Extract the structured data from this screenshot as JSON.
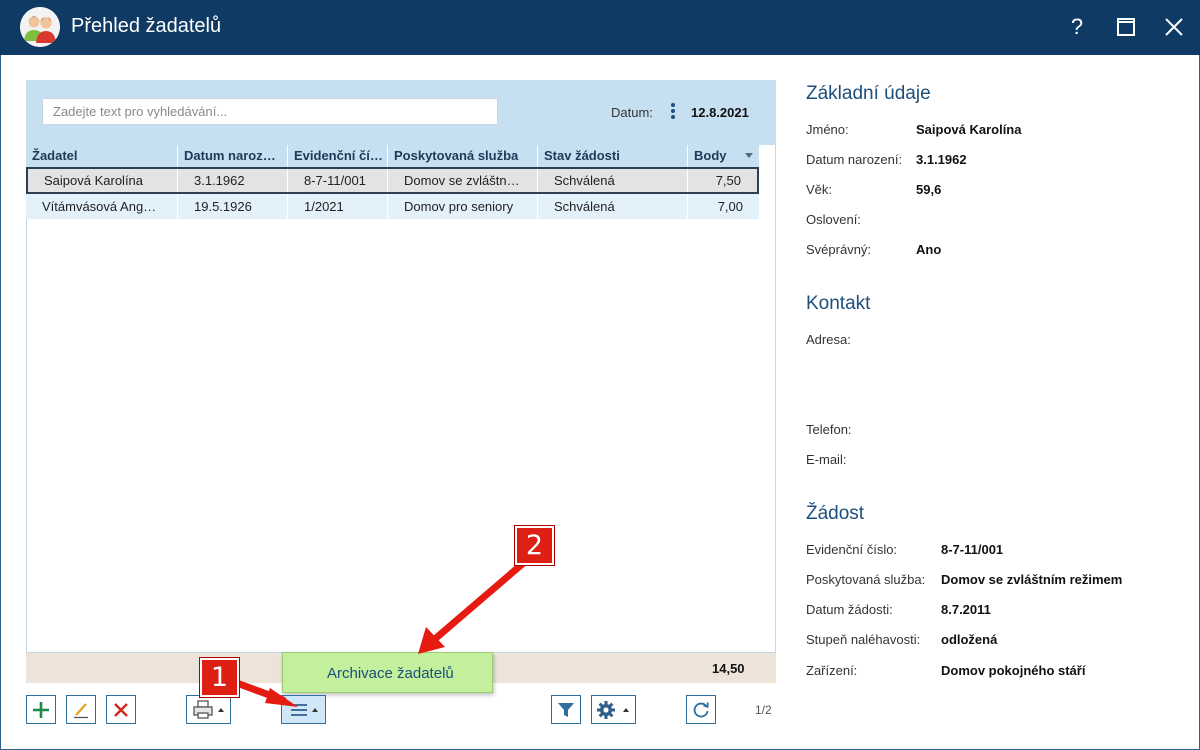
{
  "window": {
    "title": "Přehled žadatelů",
    "help": "?",
    "maximize": "☐",
    "close": "✕"
  },
  "search": {
    "placeholder": "Zadejte text pro vyhledávání..."
  },
  "date": {
    "label": "Datum:",
    "value": "12.8.2021"
  },
  "columns": [
    "Žadatel",
    "Datum naroz…",
    "Evidenční čí…",
    "Poskytovaná služba",
    "Stav žádosti",
    "Body"
  ],
  "rows": [
    [
      "Saipová Karolína",
      "3.1.1962",
      "8-7-11/001",
      "Domov se zvláštn…",
      "Schválená",
      "7,50"
    ],
    [
      "Vítámvásová Ang…",
      "19.5.1926",
      "1/2021",
      "Domov pro seniory",
      "Schválená",
      "7,00"
    ]
  ],
  "summary": {
    "total": "14,50"
  },
  "popup": {
    "item": "Archivace žadatelů"
  },
  "callouts": {
    "one": "1",
    "two": "2"
  },
  "pager": {
    "text": "1/2"
  },
  "detail": {
    "basic": {
      "title": "Základní údaje",
      "name_label": "Jméno:",
      "name_value": "Saipová Karolína",
      "birth_label": "Datum narození:",
      "birth_value": "3.1.1962",
      "age_label": "Věk:",
      "age_value": "59,6",
      "salutation_label": "Oslovení:",
      "capacity_label": "Svéprávný:",
      "capacity_value": "Ano"
    },
    "contact": {
      "title": "Kontakt",
      "address_label": "Adresa:",
      "phone_label": "Telefon:",
      "email_label": "E-mail:"
    },
    "request": {
      "title": "Žádost",
      "number_label": "Evidenční číslo:",
      "number_value": "8-7-11/001",
      "service_label": "Poskytovaná služba:",
      "service_value": "Domov se zvláštním režimem",
      "date_label": "Datum žádosti:",
      "date_value": "8.7.2011",
      "urgency_label": "Stupeň naléhavosti:",
      "urgency_value": "odložená",
      "facility_label": "Zařízení:",
      "facility_value": "Domov pokojného stáří"
    }
  },
  "colors": {
    "titlebar": "#0e3a63",
    "header": "#c6e0f2",
    "accent_red": "#dd1f14",
    "popup": "#c4ef9c"
  },
  "icons": [
    "users-icon",
    "add-icon",
    "edit-icon",
    "delete-icon",
    "print-icon",
    "menu-icon",
    "filter-icon",
    "gear-icon",
    "refresh-icon"
  ]
}
